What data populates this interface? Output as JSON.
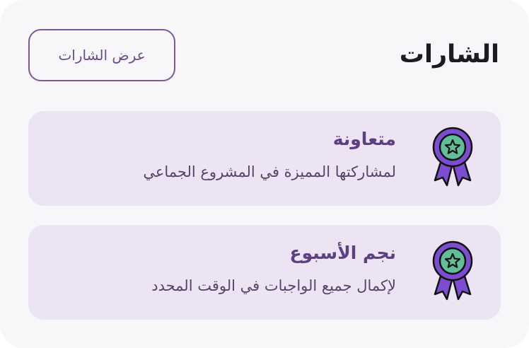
{
  "header": {
    "title": "الشارات",
    "view_all_label": "عرض الشارات"
  },
  "badges": [
    {
      "name": "متعاونة",
      "description": "لمشاركتها المميزة في المشروع الجماعي",
      "icon": "award-ribbon-icon"
    },
    {
      "name": "نجم الأسبوع",
      "description": "لإكمال جميع الواجبات في الوقت المحدد",
      "icon": "award-ribbon-icon"
    }
  ],
  "colors": {
    "accent": "#7b5a9c",
    "badge_background": "#ece3f3",
    "ribbon": "#7c4dd1",
    "medal_center": "#5fbf98"
  }
}
